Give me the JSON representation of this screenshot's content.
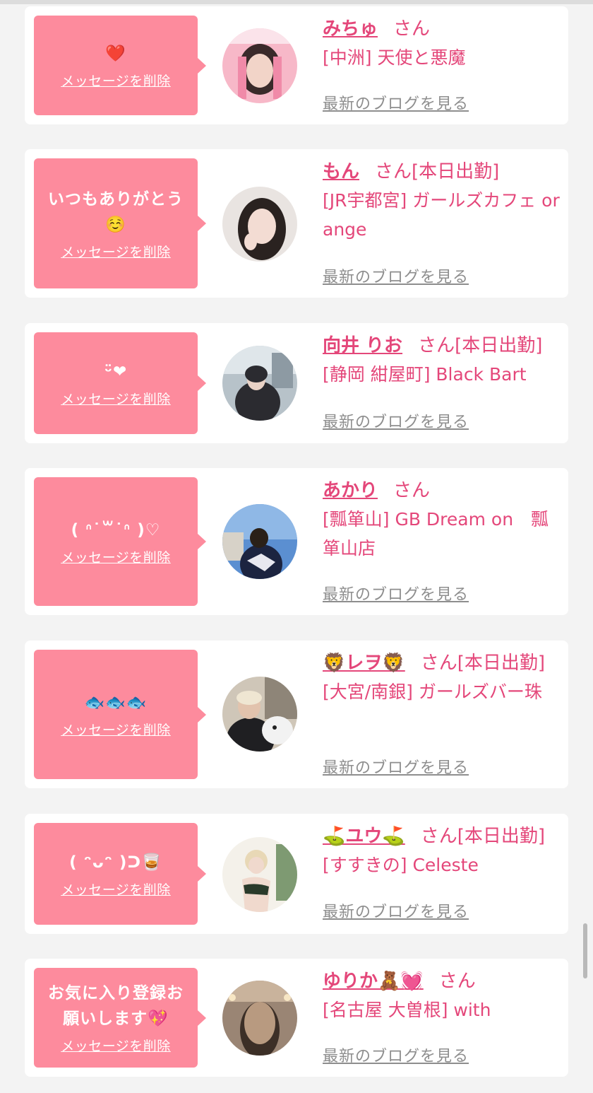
{
  "cards": [
    {
      "message": "❤️",
      "delete_label": "メッセージを削除",
      "name": "みちゅ",
      "san": "さん",
      "status": "",
      "shop": "[中洲] 天使と悪魔",
      "blog_label": "最新のブログを見る",
      "avatar_colors": [
        "#f7b8c8",
        "#3a2a2a"
      ]
    },
    {
      "message": "いつもありがとう☺️",
      "delete_label": "メッセージを削除",
      "name": "もん",
      "san": "さん",
      "status": "[本日出勤]",
      "shop": "[JR宇都宮] ガールズカフェ orange",
      "blog_label": "最新のブログを見る",
      "avatar_colors": [
        "#e9e4e1",
        "#2a2220"
      ]
    },
    {
      "message": "ᵕ̈❤",
      "delete_label": "メッセージを削除",
      "name": "向井 りお",
      "san": "さん",
      "status": "[本日出勤]",
      "shop": "[静岡 紺屋町] Black Bart",
      "blog_label": "最新のブログを見る",
      "avatar_colors": [
        "#b7c2c9",
        "#2b2b30"
      ]
    },
    {
      "message": "( ᐢ˙꒳​˙ᐢ )♡",
      "delete_label": "メッセージを削除",
      "name": "あかり",
      "san": "さん",
      "status": "",
      "shop": "[瓢箪山] GB Dream on　瓢箪山店",
      "blog_label": "最新のブログを見る",
      "avatar_colors": [
        "#5b8fd1",
        "#1c2440"
      ]
    },
    {
      "message": "🐟🐟🐟",
      "delete_label": "メッセージを削除",
      "name": "🦁レヲ🦁",
      "san": "さん",
      "status": "[本日出勤]",
      "shop": "[大宮/南銀] ガールズバー珠",
      "blog_label": "最新のブログを見る",
      "avatar_colors": [
        "#cfc6b8",
        "#1f1f22"
      ]
    },
    {
      "message": "( ᵔᴗᵔ )ᑐ🥃",
      "delete_label": "メッセージを削除",
      "name": "⛳️ユウ⛳️",
      "san": "さん",
      "status": "[本日出勤]",
      "shop": "[すすきの] Celeste",
      "blog_label": "最新のブログを見る",
      "avatar_colors": [
        "#f4f1ea",
        "#2a3a2a"
      ]
    },
    {
      "message": "お気に入り登録お願いします💖",
      "delete_label": "メッセージを削除",
      "name": "ゆりか🧸💓",
      "san": "さん",
      "status": "",
      "shop": "[名古屋 大曽根] with",
      "blog_label": "最新のブログを見る",
      "avatar_colors": [
        "#9a8574",
        "#3c2f27"
      ]
    }
  ]
}
